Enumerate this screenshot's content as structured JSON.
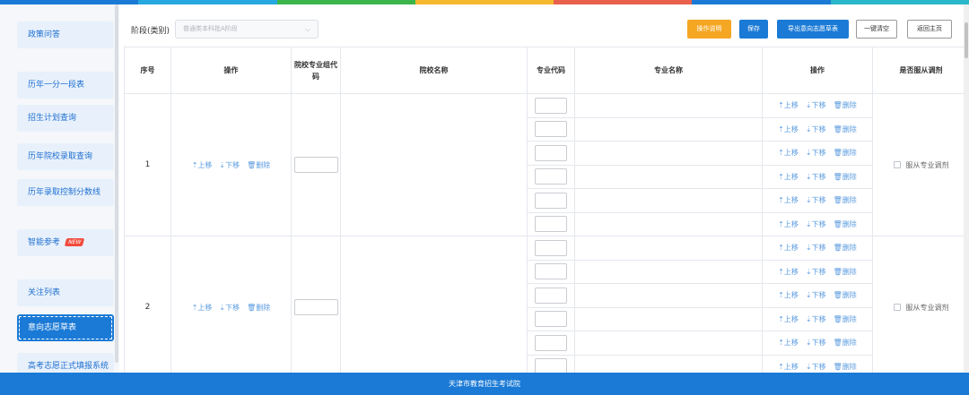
{
  "topbar_colors": [
    "#1a7ad6",
    "#27a8e0",
    "#3cb54a",
    "#f5b82e",
    "#e9604d",
    "#1a7ad6",
    "#2ab7c9"
  ],
  "sidebar": {
    "items": [
      {
        "label": "政策问答"
      },
      {
        "label": "历年一分一段表"
      },
      {
        "label": "招生计划查询"
      },
      {
        "label": "历年院校录取查询"
      },
      {
        "label": "历年录取控制分数线"
      },
      {
        "label": "智能参考",
        "badge": "NEW"
      },
      {
        "label": "关注列表"
      },
      {
        "label": "意向志愿草表",
        "active": true
      },
      {
        "label": "高考志愿正式填报系统"
      }
    ]
  },
  "toolbar": {
    "stage_label": "阶段(类别)",
    "stage_value": "普通类本科批A阶段",
    "help_label": "操作说明",
    "save_label": "保存",
    "export_label": "导出意向志愿草表",
    "clear_label": "一键清空",
    "home_label": "返回主页"
  },
  "table": {
    "headers": [
      "序号",
      "操作",
      "院校专业组代码",
      "院校名称",
      "专业代码",
      "专业名称",
      "操作",
      "是否服从调剂"
    ],
    "ops": {
      "up": "上移",
      "down": "下移",
      "del": "删除"
    },
    "rows": [
      {
        "index": "1",
        "sub_count": 6,
        "adjust_label": "服从专业调剂"
      },
      {
        "index": "2",
        "sub_count": 6,
        "adjust_label": "服从专业调剂"
      }
    ]
  },
  "footer": {
    "text": "天津市教育招生考试院"
  }
}
